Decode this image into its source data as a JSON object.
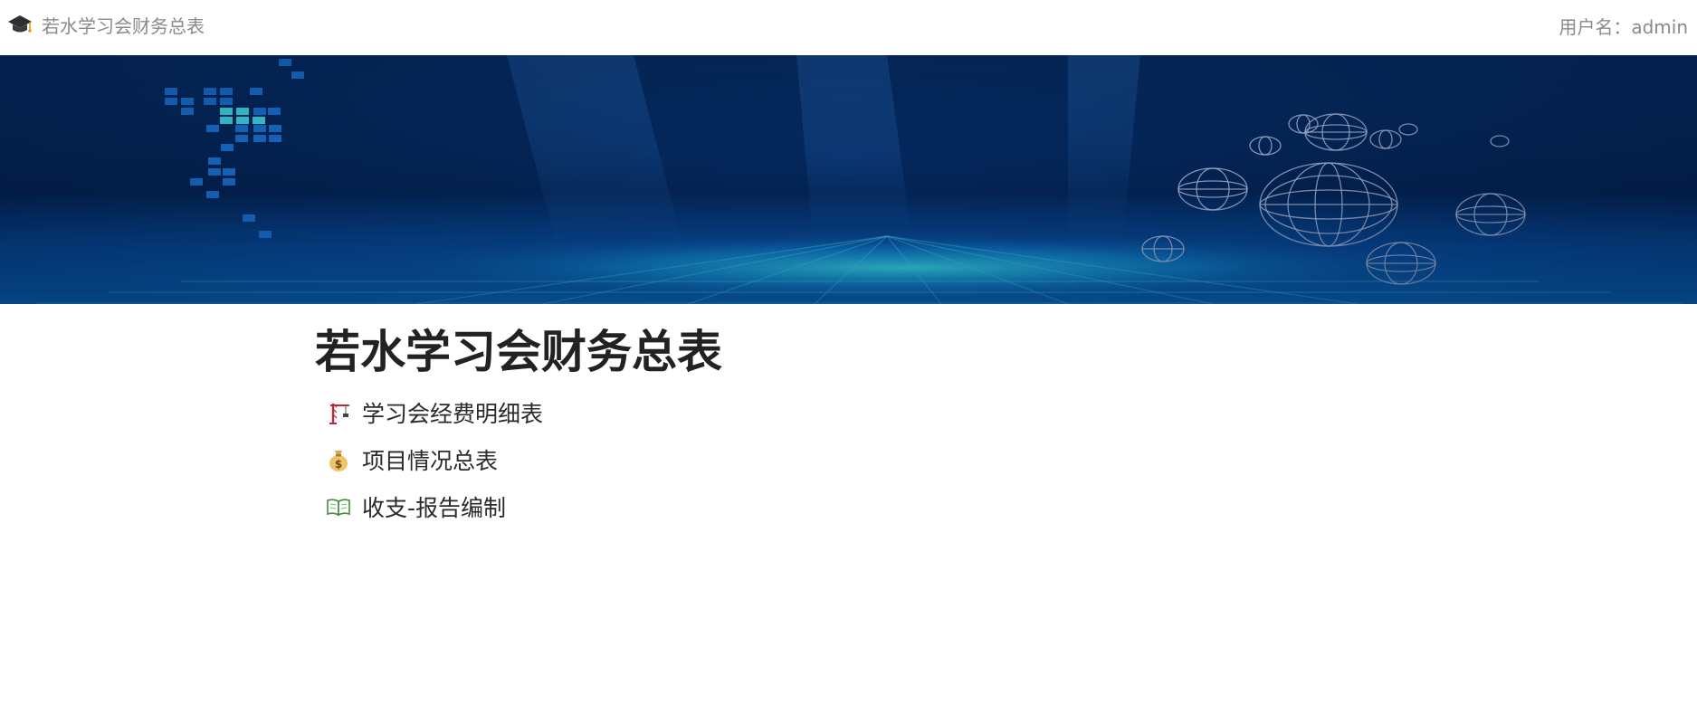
{
  "header": {
    "app_icon": "graduation-cap-icon",
    "app_title": "若水学习会财务总表",
    "user_label": "用户名：admin"
  },
  "banner": {
    "description_theme": "technology-globes",
    "colors": {
      "deep": "#03265a",
      "mid": "#0a4a9a",
      "glow": "#22d8ff",
      "pixel": "#1e8cff",
      "pixel_bright": "#3ff0ff",
      "globe_line": "#b9c8ea"
    }
  },
  "main": {
    "title": "若水学习会财务总表",
    "links": [
      {
        "icon": "crane-icon",
        "label": "学习会经费明细表"
      },
      {
        "icon": "money-bag-icon",
        "label": "项目情况总表"
      },
      {
        "icon": "open-book-icon",
        "label": "收支-报告编制"
      }
    ]
  },
  "colors": {
    "muted_text": "#8a8a8a",
    "heading_text": "#222222",
    "body_text": "#2a2a2a"
  }
}
